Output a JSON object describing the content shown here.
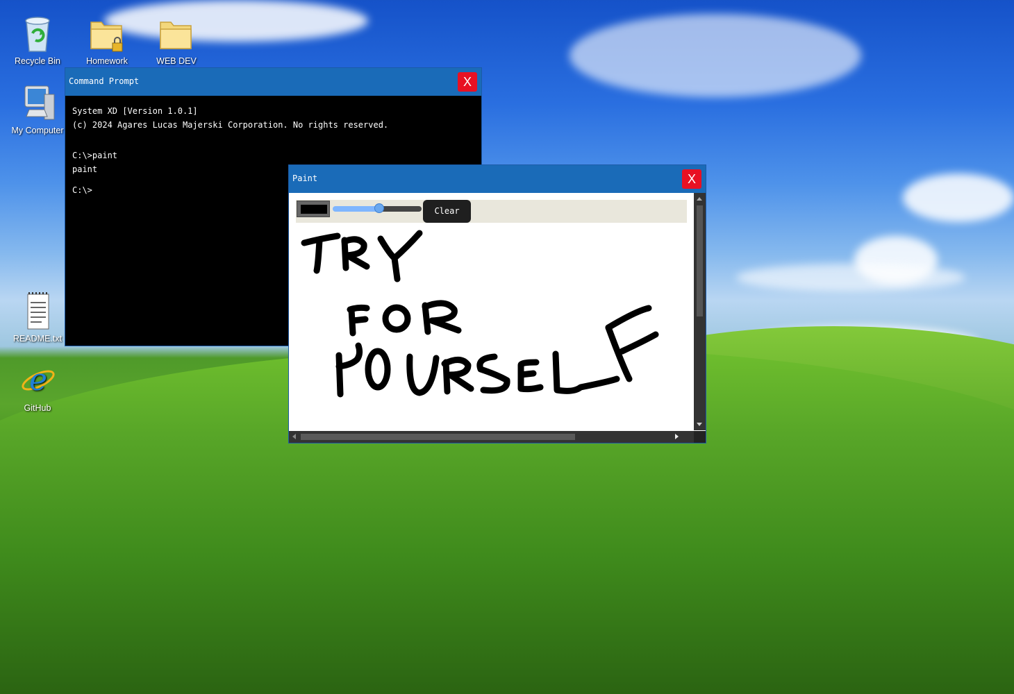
{
  "desktop": {
    "icons": [
      {
        "label": "Recycle Bin",
        "icon": "recycle-bin-icon"
      },
      {
        "label": "Homework",
        "icon": "locked-folder-icon"
      },
      {
        "label": "WEB DEV",
        "icon": "folder-icon"
      },
      {
        "label": "My Computer",
        "icon": "computer-icon"
      },
      {
        "label": "README.txt",
        "icon": "notepad-icon"
      },
      {
        "label": "GitHub",
        "icon": "internet-explorer-icon"
      }
    ]
  },
  "cmd_window": {
    "title": "Command Prompt",
    "close_label": "X",
    "lines": [
      "System XD [Version 1.0.1]",
      "(c) 2024 Agares Lucas Majerski Corporation. No rights reserved.",
      "",
      "C:\\>paint",
      "paint",
      "C:\\>"
    ]
  },
  "paint_window": {
    "title": "Paint",
    "close_label": "X",
    "toolbar": {
      "color": "#000000",
      "brush_size_fraction": 0.52,
      "clear_label": "Clear"
    },
    "canvas_text": "TRY FOR YOURSELF"
  },
  "colors": {
    "titlebar": "#1a6bb8",
    "close": "#e81123"
  }
}
